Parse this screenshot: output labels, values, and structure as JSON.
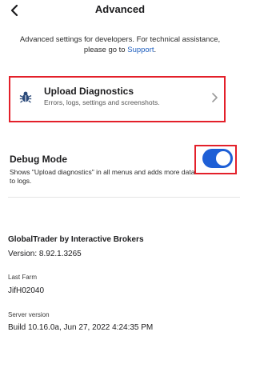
{
  "header": {
    "back_icon": "chevron-left-icon",
    "title": "Advanced"
  },
  "intro": {
    "text": "Advanced settings for developers. For technical assistance, please go to",
    "link": "Support",
    "suffix": "."
  },
  "upload_diagnostics": {
    "icon": "bug-icon",
    "title": "Upload Diagnostics",
    "subtitle": "Errors, logs, settings and screenshots.",
    "chevron_icon": "chevron-right-icon"
  },
  "debug_mode": {
    "title": "Debug Mode",
    "description": "Shows \"Upload diagnostics\" in all menus and adds more data to logs.",
    "enabled": true
  },
  "info": {
    "app_name": "GlobalTrader by Interactive Brokers",
    "version": "Version: 8.92.1.3265",
    "last_farm_label": "Last Farm",
    "last_farm_value": "JifH02040",
    "server_version_label": "Server version",
    "server_version_value": "Build 10.16.0a, Jun 27, 2022 4:24:35 PM"
  },
  "colors": {
    "accent": "#1e5fd6",
    "link": "#1f5fbf",
    "highlight": "#e3202a",
    "bug_icon": "#2b4a7a"
  }
}
